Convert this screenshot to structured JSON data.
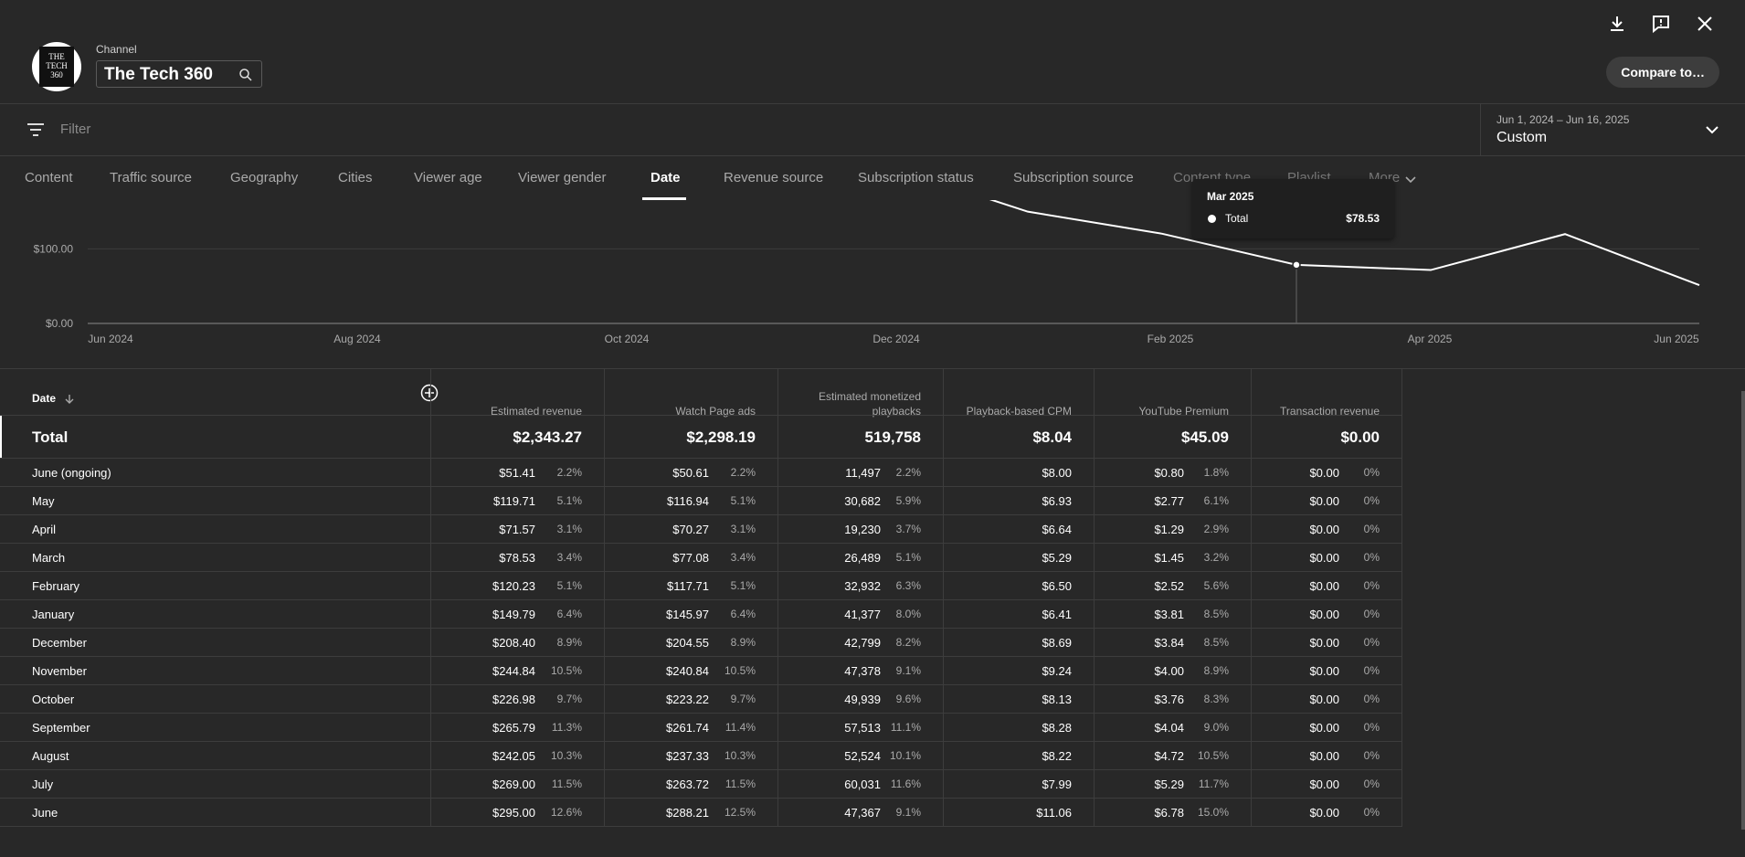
{
  "header": {
    "channel_label": "Channel",
    "channel_name": "The Tech 360",
    "compare_label": "Compare to…",
    "avatar_text": "THE TECH 360"
  },
  "filter": {
    "placeholder": "Filter"
  },
  "date_range": {
    "range": "Jun 1, 2024 – Jun 16, 2025",
    "preset": "Custom"
  },
  "tabs": [
    {
      "label": "Content"
    },
    {
      "label": "Traffic source"
    },
    {
      "label": "Geography"
    },
    {
      "label": "Cities"
    },
    {
      "label": "Viewer age"
    },
    {
      "label": "Viewer gender"
    },
    {
      "label": "Date"
    },
    {
      "label": "Revenue source"
    },
    {
      "label": "Subscription status"
    },
    {
      "label": "Subscription source"
    },
    {
      "label": "Content type"
    },
    {
      "label": "Playlist"
    },
    {
      "label": "More"
    }
  ],
  "chart_data": {
    "type": "line",
    "y_ticks": [
      "$100.00",
      "$0.00"
    ],
    "x_ticks": [
      "Jun 2024",
      "Aug 2024",
      "Oct 2024",
      "Dec 2024",
      "Feb 2025",
      "Apr 2025",
      "Jun 2025"
    ],
    "series": [
      {
        "name": "Total",
        "values": [
          295.0,
          269.0,
          242.05,
          265.79,
          226.98,
          244.84,
          208.4,
          149.79,
          120.23,
          78.53,
          71.57,
          119.71,
          51.41
        ]
      }
    ],
    "ylim": [
      0,
      300
    ]
  },
  "tooltip": {
    "title": "Mar 2025",
    "series": "Total",
    "value": "$78.53"
  },
  "table": {
    "date_header": "Date",
    "columns": [
      "Estimated revenue",
      "Watch Page ads",
      "Estimated monetized playbacks",
      "Playback-based CPM",
      "YouTube Premium",
      "Transaction revenue"
    ],
    "total": {
      "label": "Total",
      "values": [
        "$2,343.27",
        "$2,298.19",
        "519,758",
        "$8.04",
        "$45.09",
        "$0.00"
      ]
    },
    "rows": [
      {
        "label": "June (ongoing)",
        "v": [
          "$51.41",
          "2.2%",
          "$50.61",
          "2.2%",
          "11,497",
          "2.2%",
          "$8.00",
          "$0.80",
          "1.8%",
          "$0.00",
          "0%"
        ]
      },
      {
        "label": "May",
        "v": [
          "$119.71",
          "5.1%",
          "$116.94",
          "5.1%",
          "30,682",
          "5.9%",
          "$6.93",
          "$2.77",
          "6.1%",
          "$0.00",
          "0%"
        ]
      },
      {
        "label": "April",
        "v": [
          "$71.57",
          "3.1%",
          "$70.27",
          "3.1%",
          "19,230",
          "3.7%",
          "$6.64",
          "$1.29",
          "2.9%",
          "$0.00",
          "0%"
        ]
      },
      {
        "label": "March",
        "v": [
          "$78.53",
          "3.4%",
          "$77.08",
          "3.4%",
          "26,489",
          "5.1%",
          "$5.29",
          "$1.45",
          "3.2%",
          "$0.00",
          "0%"
        ]
      },
      {
        "label": "February",
        "v": [
          "$120.23",
          "5.1%",
          "$117.71",
          "5.1%",
          "32,932",
          "6.3%",
          "$6.50",
          "$2.52",
          "5.6%",
          "$0.00",
          "0%"
        ]
      },
      {
        "label": "January",
        "v": [
          "$149.79",
          "6.4%",
          "$145.97",
          "6.4%",
          "41,377",
          "8.0%",
          "$6.41",
          "$3.81",
          "8.5%",
          "$0.00",
          "0%"
        ]
      },
      {
        "label": "December",
        "v": [
          "$208.40",
          "8.9%",
          "$204.55",
          "8.9%",
          "42,799",
          "8.2%",
          "$8.69",
          "$3.84",
          "8.5%",
          "$0.00",
          "0%"
        ]
      },
      {
        "label": "November",
        "v": [
          "$244.84",
          "10.5%",
          "$240.84",
          "10.5%",
          "47,378",
          "9.1%",
          "$9.24",
          "$4.00",
          "8.9%",
          "$0.00",
          "0%"
        ]
      },
      {
        "label": "October",
        "v": [
          "$226.98",
          "9.7%",
          "$223.22",
          "9.7%",
          "49,939",
          "9.6%",
          "$8.13",
          "$3.76",
          "8.3%",
          "$0.00",
          "0%"
        ]
      },
      {
        "label": "September",
        "v": [
          "$265.79",
          "11.3%",
          "$261.74",
          "11.4%",
          "57,513",
          "11.1%",
          "$8.28",
          "$4.04",
          "9.0%",
          "$0.00",
          "0%"
        ]
      },
      {
        "label": "August",
        "v": [
          "$242.05",
          "10.3%",
          "$237.33",
          "10.3%",
          "52,524",
          "10.1%",
          "$8.22",
          "$4.72",
          "10.5%",
          "$0.00",
          "0%"
        ]
      },
      {
        "label": "July",
        "v": [
          "$269.00",
          "11.5%",
          "$263.72",
          "11.5%",
          "60,031",
          "11.6%",
          "$7.99",
          "$5.29",
          "11.7%",
          "$0.00",
          "0%"
        ]
      },
      {
        "label": "June",
        "v": [
          "$295.00",
          "12.6%",
          "$288.21",
          "12.5%",
          "47,367",
          "9.1%",
          "$11.06",
          "$6.78",
          "15.0%",
          "$0.00",
          "0%"
        ]
      }
    ]
  }
}
